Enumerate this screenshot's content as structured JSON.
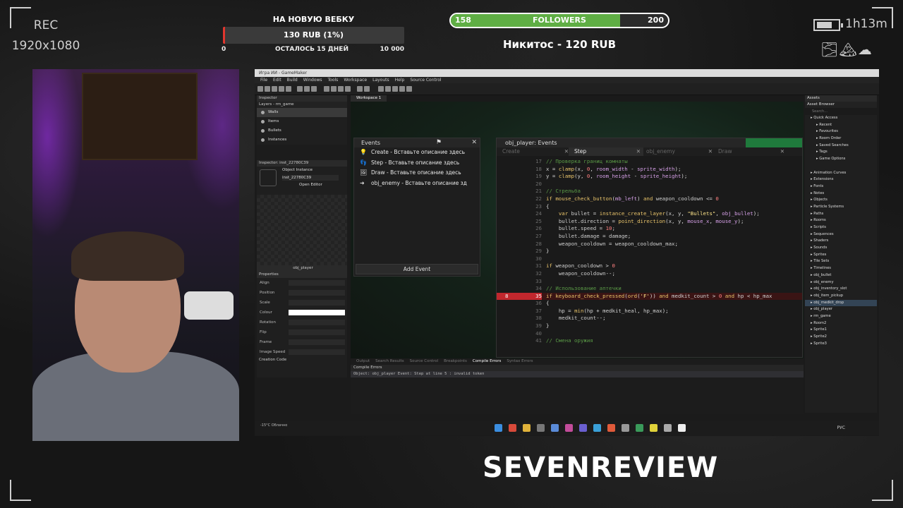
{
  "overlay": {
    "rec_label": "REC",
    "resolution": "1920x1080",
    "goal": {
      "title": "НА НОВУЮ ВЕБКУ",
      "amount": "130 RUB (1%)",
      "progress": 0.013,
      "min": "0",
      "remaining": "ОСТАЛОСЬ 15 ДНЕЙ",
      "max": "10 000",
      "fill_color": "#e0362e"
    },
    "followers": {
      "label": "FOLLOWERS",
      "min": "158",
      "max": "200",
      "progress": 0.78,
      "fill_color": "#5fae44"
    },
    "last_donation": "Никитос - 120 RUB",
    "timer": "1h13m",
    "weather_icons": "🌫🏔☁",
    "brand": "SEVENREVIEW"
  },
  "app": {
    "title": "Игра ИИ - GameMaker",
    "menu": [
      "File",
      "Edit",
      "Build",
      "Windows",
      "Tools",
      "Workspace",
      "Layouts",
      "Help",
      "Source Control"
    ],
    "left_panel": {
      "tab": "Inspector",
      "layers_title": "Layers - rm_game",
      "layers": [
        "Walls",
        "Items",
        "Bullets",
        "Instances"
      ],
      "inspector_title": "Inspector: inst_22780C39",
      "object_instance_label": "Object Instance",
      "instance_name": "inst_22780C39",
      "open_editor": "Open Editor",
      "object_name": "obj_player",
      "properties_title": "Properties",
      "props": [
        "Align",
        "Position",
        "Scale",
        "Colour",
        "Rotation",
        "Flip",
        "Frame",
        "Image Speed"
      ],
      "creation_code": "Creation Code"
    },
    "workspace_tab": "Workspace 1",
    "events_panel": {
      "title": "Events",
      "items": [
        {
          "icon": "💡",
          "label": "Create - Вставьте описание здесь"
        },
        {
          "icon": "👣",
          "label": "Step - Вставьте описание здесь"
        },
        {
          "icon": "🖼",
          "label": "Draw - Вставьте описание здесь"
        },
        {
          "icon": "➜",
          "label": "obj_enemy - Вставьте описание зд"
        }
      ],
      "add_event": "Add Event"
    },
    "code_editor": {
      "title": "obj_player: Events",
      "tabs": [
        "Create",
        "Step",
        "obj_enemy",
        "Draw"
      ],
      "active_tab": "Step",
      "lines": [
        {
          "n": "17",
          "html": "<span class='c-com'>// Проверка границ комнаты</span>"
        },
        {
          "n": "18",
          "html": "<span class='c-var'>x</span> = <span class='c-fn'>clamp</span>(<span class='c-var'>x</span>, <span class='c-num'>0</span>, <span class='c-builtin'>room_width</span> - <span class='c-builtin'>sprite_width</span>);"
        },
        {
          "n": "19",
          "html": "<span class='c-var'>y</span> = <span class='c-fn'>clamp</span>(<span class='c-var'>y</span>, <span class='c-num'>0</span>, <span class='c-builtin'>room_height</span> - <span class='c-builtin'>sprite_height</span>);"
        },
        {
          "n": "20",
          "html": ""
        },
        {
          "n": "21",
          "html": "<span class='c-com'>// Стрельба</span>"
        },
        {
          "n": "22",
          "html": "<span class='c-kw'>if</span> <span class='c-fn'>mouse_check_button</span>(<span class='c-builtin'>mb_left</span>) <span class='c-kw'>and</span> <span class='c-var'>weapon_cooldown</span> &lt;= <span class='c-num'>0</span>"
        },
        {
          "n": "23",
          "html": "{"
        },
        {
          "n": "24",
          "html": "    <span class='c-kw'>var</span> <span class='c-var'>bullet</span> = <span class='c-fn'>instance_create_layer</span>(<span class='c-var'>x</span>, <span class='c-var'>y</span>, <span class='c-str'>\"Bullets\"</span>, <span class='c-builtin'>obj_bullet</span>);"
        },
        {
          "n": "25",
          "html": "    <span class='c-var'>bullet</span>.<span class='c-var'>direction</span> = <span class='c-fn'>point_direction</span>(<span class='c-var'>x</span>, <span class='c-var'>y</span>, <span class='c-builtin'>mouse_x</span>, <span class='c-builtin'>mouse_y</span>);"
        },
        {
          "n": "26",
          "html": "    <span class='c-var'>bullet</span>.<span class='c-var'>speed</span> = <span class='c-num'>10</span>;"
        },
        {
          "n": "27",
          "html": "    <span class='c-var'>bullet</span>.<span class='c-var'>damage</span> = <span class='c-var'>damage</span>;"
        },
        {
          "n": "28",
          "html": "    <span class='c-var'>weapon_cooldown</span> = <span class='c-var'>weapon_cooldown_max</span>;"
        },
        {
          "n": "29",
          "html": "}"
        },
        {
          "n": "30",
          "html": ""
        },
        {
          "n": "31",
          "html": "<span class='c-kw'>if</span> <span class='c-var'>weapon_cooldown</span> &gt; <span class='c-num'>0</span>"
        },
        {
          "n": "32",
          "html": "    <span class='c-var'>weapon_cooldown</span>--;"
        },
        {
          "n": "33",
          "html": ""
        },
        {
          "n": "34",
          "html": "<span class='c-com'>// Использование аптечки</span>"
        },
        {
          "n": "35",
          "html": "<span class='c-kw'>if</span> <span class='c-fn'>keyboard_check_pressed</span>(<span class='c-fn'>ord</span>(<span class='c-str'>'F'</span>)) <span class='c-kw'>and</span> <span class='c-var'>medkit_count</span> &gt; <span class='c-num'>0</span> <span class='c-kw'>and</span> <span class='c-var'>hp</span> &lt; <span class='c-var'>hp_max</span>",
          "error": true
        },
        {
          "n": "36",
          "html": "{"
        },
        {
          "n": "37",
          "html": "    <span class='c-var'>hp</span> = <span class='c-fn'>min</span>(<span class='c-var'>hp</span> + <span class='c-var'>medkit_heal</span>, <span class='c-var'>hp_max</span>);"
        },
        {
          "n": "38",
          "html": "    <span class='c-var'>medkit_count</span>--;"
        },
        {
          "n": "39",
          "html": "}"
        },
        {
          "n": "40",
          "html": ""
        },
        {
          "n": "41",
          "html": "<span class='c-com'>// Смена оружия</span>"
        }
      ],
      "breakpoint_symbol": "8"
    },
    "bottom_tabs": [
      "Output",
      "Search Results",
      "Source Control",
      "Breakpoints",
      "Compile Errors",
      "Syntax Errors"
    ],
    "active_bottom_tab": "Compile Errors",
    "compile_title": "Compile Errors",
    "compile_msg": "Object: obj_player Event: Step at line 5 : invalid token",
    "asset_panel": {
      "tab": "Assets",
      "title": "Asset Browser",
      "search_placeholder": "Search...",
      "items": [
        "Quick Access",
        "  Recent",
        "  Favourites",
        "  Room Order",
        "  Saved Searches",
        "  Tags",
        "  Game Options",
        "",
        "Animation Curves",
        "Extensions",
        "Fonts",
        "Notes",
        "Objects",
        "Particle Systems",
        "Paths",
        "Rooms",
        "Scripts",
        "Sequences",
        "Shaders",
        "Sounds",
        "Sprites",
        "Tile Sets",
        "Timelines",
        "obj_bullet",
        "obj_enemy",
        "obj_inventory_slot",
        "obj_item_pickup",
        "obj_medkit_drop",
        "obj_player",
        "rm_game",
        "Room2",
        "Sprite1",
        "Sprite2",
        "Sprite3"
      ],
      "selected": "obj_medkit_drop"
    },
    "taskbar": {
      "weather": "-15°C Облачно",
      "lang": "РУС"
    }
  }
}
